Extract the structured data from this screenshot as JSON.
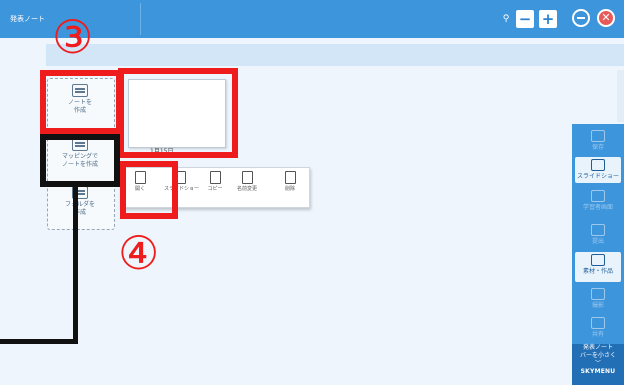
{
  "titlebar": {
    "app_title": "発表ノート",
    "zoom_out_label": "−",
    "zoom_in_label": "+",
    "close_label": "✕"
  },
  "toolbox": {
    "create_note": "ノートを\n作成",
    "create_mapping": "マッピングで\nノートを作成",
    "create_folder": "フォルダを\n作成"
  },
  "note_card": {
    "date": "1月15日"
  },
  "context_menu": {
    "items": [
      {
        "label": "開く"
      },
      {
        "label": "スライドショー"
      },
      {
        "label": "コピー"
      },
      {
        "label": "名前変更"
      },
      {
        "label": "削除"
      }
    ]
  },
  "annotations": {
    "step_3": "③",
    "step_4": "④"
  },
  "side_panel": {
    "items": [
      {
        "label": "保存"
      },
      {
        "label": "スライドショー"
      },
      {
        "label": "学習者画面"
      },
      {
        "label": "提出"
      },
      {
        "label": "素材・作品"
      },
      {
        "label": "撮影"
      },
      {
        "label": "共有"
      }
    ],
    "footer_title": "発表ノート",
    "footer_shrink": "バーを小さく",
    "brand": "SKYMENU"
  },
  "colors": {
    "titlebar": "#3d95dc",
    "highlight_red": "#ee1c1c",
    "highlight_black": "#111111"
  }
}
